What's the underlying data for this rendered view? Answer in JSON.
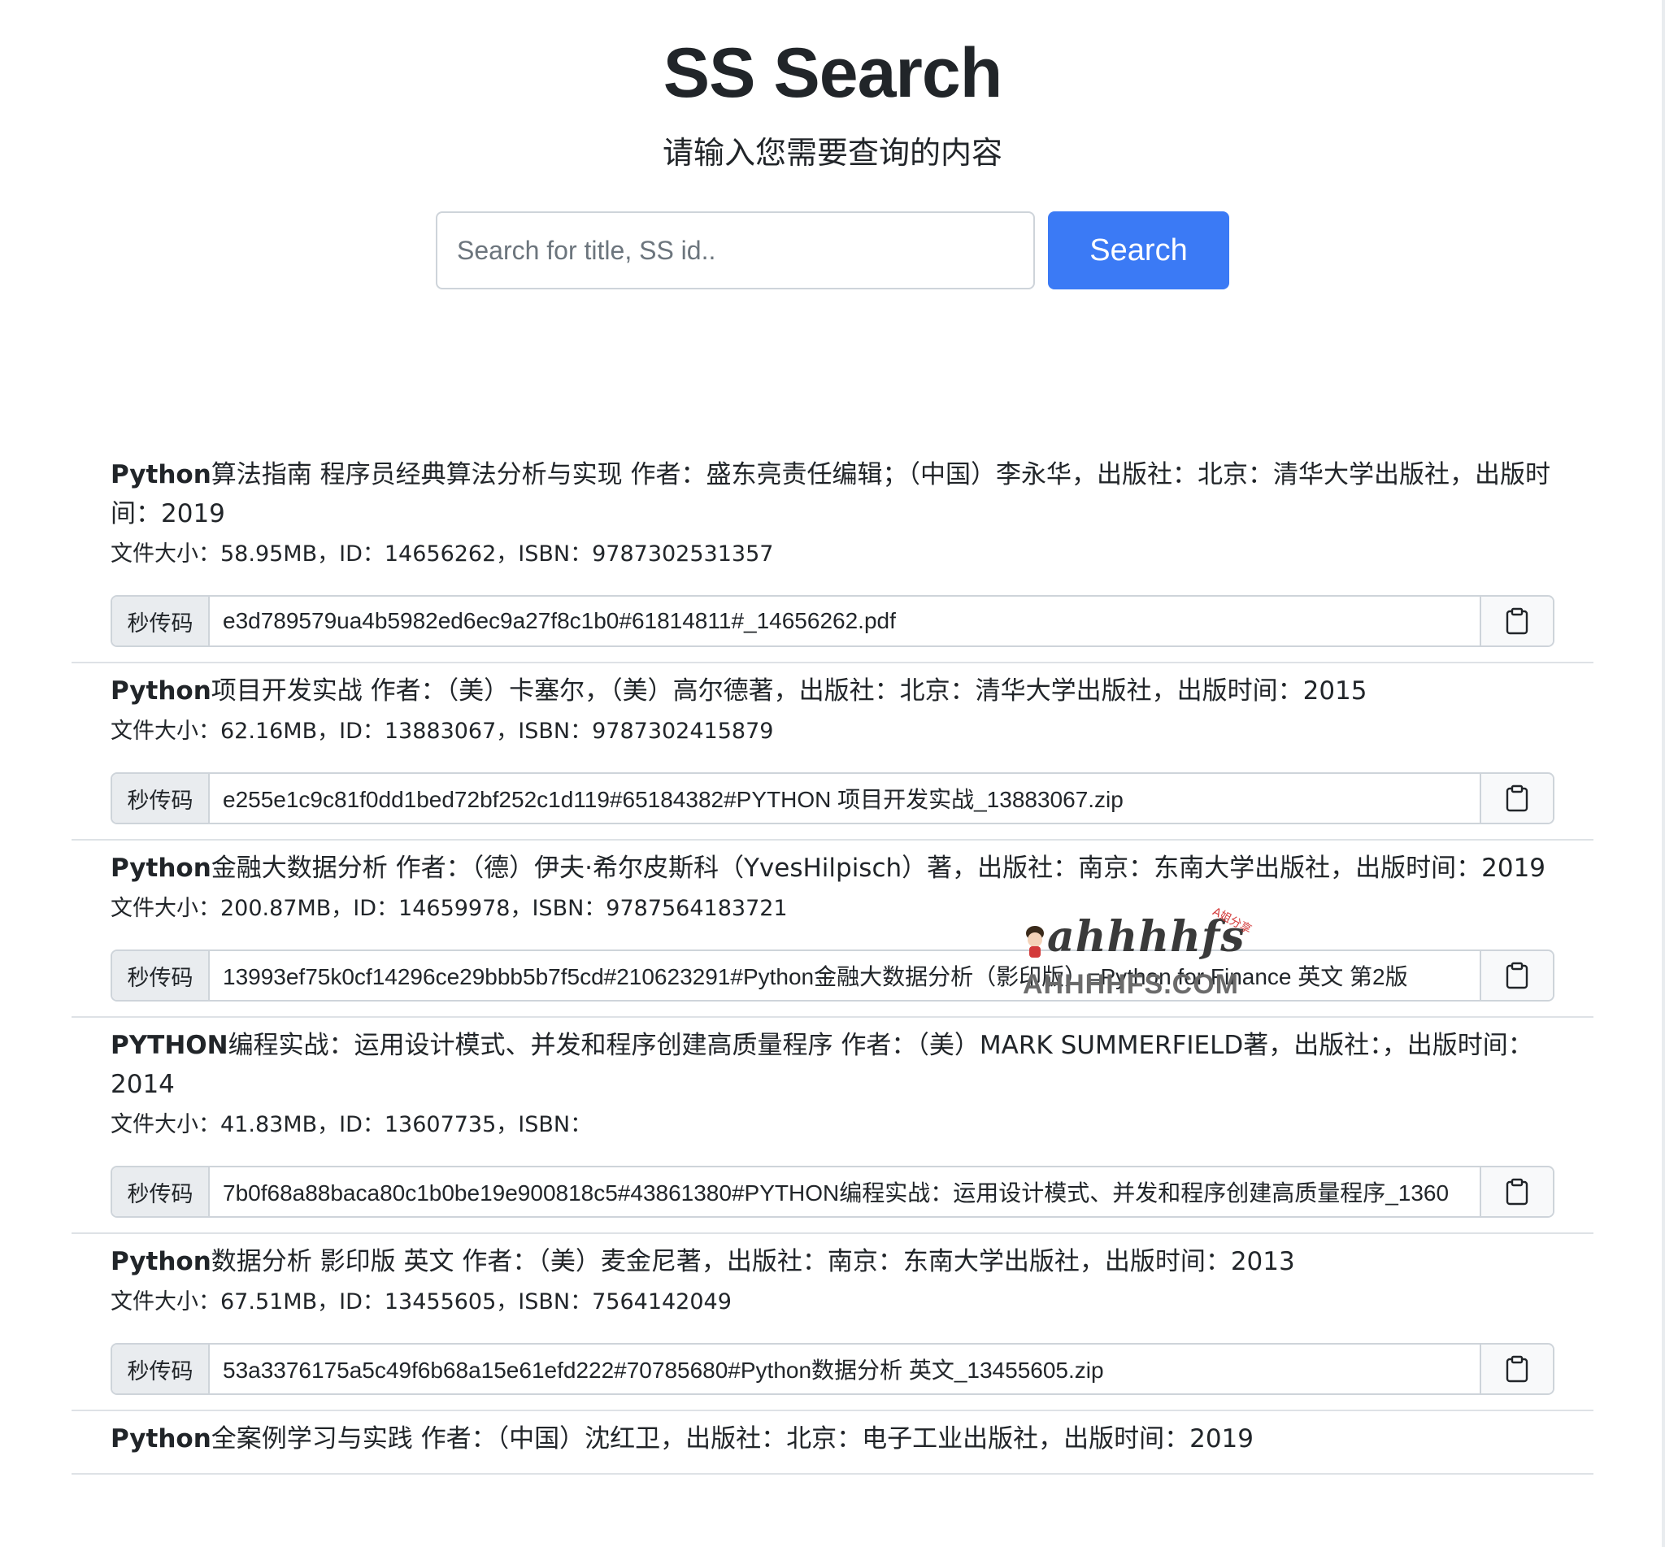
{
  "header": {
    "title": "SS Search",
    "subtitle": "请输入您需要查询的内容"
  },
  "search": {
    "placeholder": "Search for title, SS id..",
    "value": "",
    "button_label": "Search"
  },
  "code_label": "秒传码",
  "results": [
    {
      "title_bold": "Python",
      "title_rest": "算法指南 程序员经典算法分析与实现 作者：盛东亮责任编辑；（中国）李永华，出版社：北京：清华大学出版社，出版时间：2019",
      "meta": "文件大小：58.95MB，ID：14656262，ISBN：9787302531357",
      "code": "e3d789579ua4b5982ed6ec9a27f8c1b0#61814811#_14656262.pdf"
    },
    {
      "title_bold": "Python",
      "title_rest": "项目开发实战 作者：（美）卡塞尔，（美）高尔德著，出版社：北京：清华大学出版社，出版时间：2015",
      "meta": "文件大小：62.16MB，ID：13883067，ISBN：9787302415879",
      "code": "e255e1c9c81f0dd1bed72bf252c1d119#65184382#PYTHON 项目开发实战_13883067.zip"
    },
    {
      "title_bold": "Python",
      "title_rest": "金融大数据分析 作者：（德）伊夫·希尔皮斯科（YvesHilpisch）著，出版社：南京：东南大学出版社，出版时间：2019",
      "meta": "文件大小：200.87MB，ID：14659978，ISBN：9787564183721",
      "code": "13993ef75k0cf14296ce29bbb5b7f5cd#210623291#Python金融大数据分析（影印版）=Python for Finance 英文 第2版"
    },
    {
      "title_bold": "PYTHON",
      "title_rest": "编程实战：运用设计模式、并发和程序创建高质量程序 作者：（美）MARK SUMMERFIELD著，出版社：，出版时间：2014",
      "meta": "文件大小：41.83MB，ID：13607735，ISBN：",
      "code": "7b0f68a88baca80c1b0be19e900818c5#43861380#PYTHON编程实战：运用设计模式、并发和程序创建高质量程序_1360"
    },
    {
      "title_bold": "Python",
      "title_rest": "数据分析 影印版 英文 作者：（美）麦金尼著，出版社：南京：东南大学出版社，出版时间：2013",
      "meta": "文件大小：67.51MB，ID：13455605，ISBN：7564142049",
      "code": "53a3376175a5c49f6b68a15e61efd222#70785680#Python数据分析 英文_13455605.zip"
    },
    {
      "title_bold": "Python",
      "title_rest": "全案例学习与实践 作者：（中国）沈红卫，出版社：北京：电子工业出版社，出版时间：2019",
      "meta": "",
      "code": ""
    }
  ],
  "watermark": {
    "logo_text": "ahhhhfs",
    "site": "AHHHHFS.COM",
    "badge": "A姐分享"
  },
  "colors": {
    "primary": "#3b7af5",
    "text": "#212529",
    "border": "#ced4da",
    "label_bg": "#e9ecef"
  }
}
